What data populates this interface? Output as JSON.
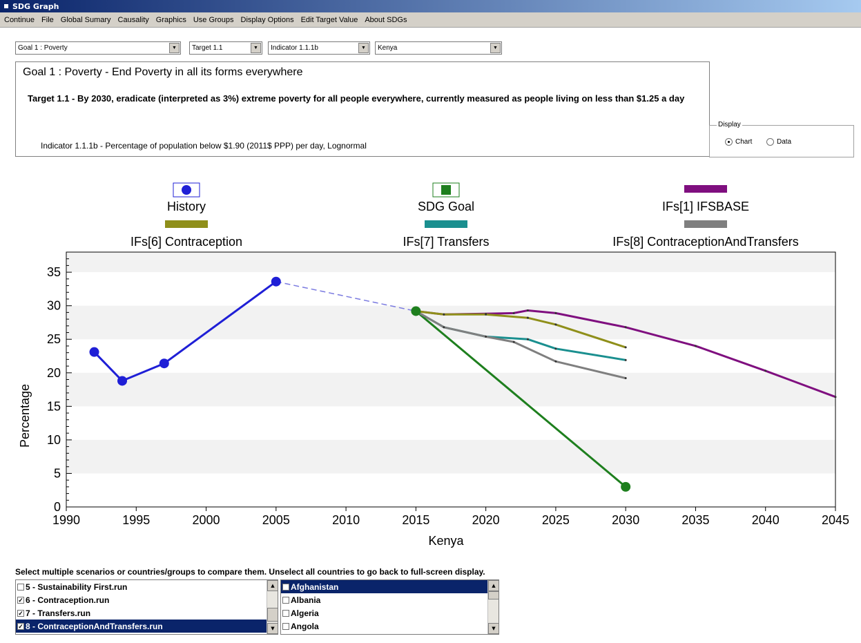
{
  "window": {
    "title": "SDG Graph"
  },
  "menu": [
    "Continue",
    "File",
    "Global Sumary",
    "Causality",
    "Graphics",
    "Use Groups",
    "Display Options",
    "Edit Target Value",
    "About SDGs"
  ],
  "selectors": {
    "goal": "Goal 1 : Poverty",
    "target": "Target 1.1",
    "indicator": "Indicator 1.1.1b",
    "country": "Kenya"
  },
  "description": {
    "goal_title": "Goal 1 : Poverty - End Poverty in all its forms everywhere",
    "target_text": "Target 1.1 - By 2030, eradicate (interpreted as 3%) extreme poverty for all people everywhere, currently measured as people living on less than $1.25 a day",
    "indicator_text": "Indicator 1.1.1b - Percentage of population below $1.90 (2011$ PPP) per day, Lognormal"
  },
  "display": {
    "label": "Display",
    "options": [
      {
        "label": "Chart",
        "selected": true
      },
      {
        "label": "Data",
        "selected": false
      }
    ]
  },
  "chart_data": {
    "type": "line",
    "xlabel": "Kenya",
    "ylabel": "Percentage",
    "xlim": [
      1990,
      2045
    ],
    "ylim": [
      0,
      38
    ],
    "xticks": [
      1990,
      1995,
      2000,
      2005,
      2010,
      2015,
      2020,
      2025,
      2030,
      2035,
      2040,
      2045
    ],
    "yticks": [
      0,
      5,
      10,
      15,
      20,
      25,
      30,
      35
    ],
    "grid": "alternating horizontal bands",
    "legend_position": "top",
    "series": [
      {
        "name": "History",
        "color": "#1f1fd6",
        "marker": "circle",
        "x": [
          1992,
          1994,
          1997,
          2005
        ],
        "y": [
          23.1,
          18.8,
          21.4,
          33.6
        ]
      },
      {
        "name": "History link",
        "color": "#7a7ae0",
        "dashed": true,
        "x": [
          2005,
          2015
        ],
        "y": [
          33.6,
          29.2
        ]
      },
      {
        "name": "SDG Goal",
        "color": "#1e7f1e",
        "marker": "circle",
        "x": [
          2015,
          2030
        ],
        "y": [
          29.2,
          3.0
        ]
      },
      {
        "name": "IFs[1] IFSBASE",
        "color": "#7f0f7f",
        "x": [
          2015,
          2017,
          2020,
          2022,
          2023,
          2025,
          2030,
          2035,
          2040,
          2045
        ],
        "y": [
          29.2,
          28.7,
          28.8,
          28.9,
          29.3,
          28.9,
          26.8,
          24.0,
          20.3,
          16.4
        ]
      },
      {
        "name": "IFs[6] Contraception",
        "color": "#8f8f1a",
        "x": [
          2015,
          2017,
          2020,
          2023,
          2025,
          2030
        ],
        "y": [
          29.2,
          28.7,
          28.7,
          28.2,
          27.2,
          23.8
        ]
      },
      {
        "name": "IFs[7] Transfers",
        "color": "#1a8f8f",
        "x": [
          2015,
          2017,
          2020,
          2023,
          2025,
          2030
        ],
        "y": [
          29.2,
          26.8,
          25.4,
          25.0,
          23.6,
          21.9
        ]
      },
      {
        "name": "IFs[8] ContraceptionAndTransfers",
        "color": "#7f7f7f",
        "x": [
          2015,
          2017,
          2020,
          2022,
          2025,
          2030
        ],
        "y": [
          29.2,
          26.8,
          25.4,
          24.6,
          21.7,
          19.2
        ]
      }
    ]
  },
  "legend": [
    {
      "label": "History",
      "type": "marker",
      "color": "#1f1fd6"
    },
    {
      "label": "SDG Goal",
      "type": "marker",
      "color": "#1e7f1e"
    },
    {
      "label": "IFs[1] IFSBASE",
      "type": "bar",
      "color": "#7f0f7f"
    },
    {
      "label": "IFs[6] Contraception",
      "type": "bar",
      "color": "#8f8f1a"
    },
    {
      "label": "IFs[7] Transfers",
      "type": "bar",
      "color": "#1a8f8f"
    },
    {
      "label": "IFs[8] ContraceptionAndTransfers",
      "type": "bar",
      "color": "#7f7f7f"
    }
  ],
  "instructions": "Select multiple scenarios or countries/groups to compare them. Unselect all countries to go back to full-screen display.",
  "scenarios": [
    {
      "label": "5 - Sustainability First.run",
      "checked": false,
      "selected": false
    },
    {
      "label": "6 - Contraception.run",
      "checked": true,
      "selected": false
    },
    {
      "label": "7 - Transfers.run",
      "checked": true,
      "selected": false
    },
    {
      "label": "8 - ContraceptionAndTransfers.run",
      "checked": true,
      "selected": true
    }
  ],
  "countries": [
    {
      "label": "Afghanistan",
      "checked": false,
      "selected": true
    },
    {
      "label": "Albania",
      "checked": false,
      "selected": false
    },
    {
      "label": "Algeria",
      "checked": false,
      "selected": false
    },
    {
      "label": "Angola",
      "checked": false,
      "selected": false
    }
  ]
}
